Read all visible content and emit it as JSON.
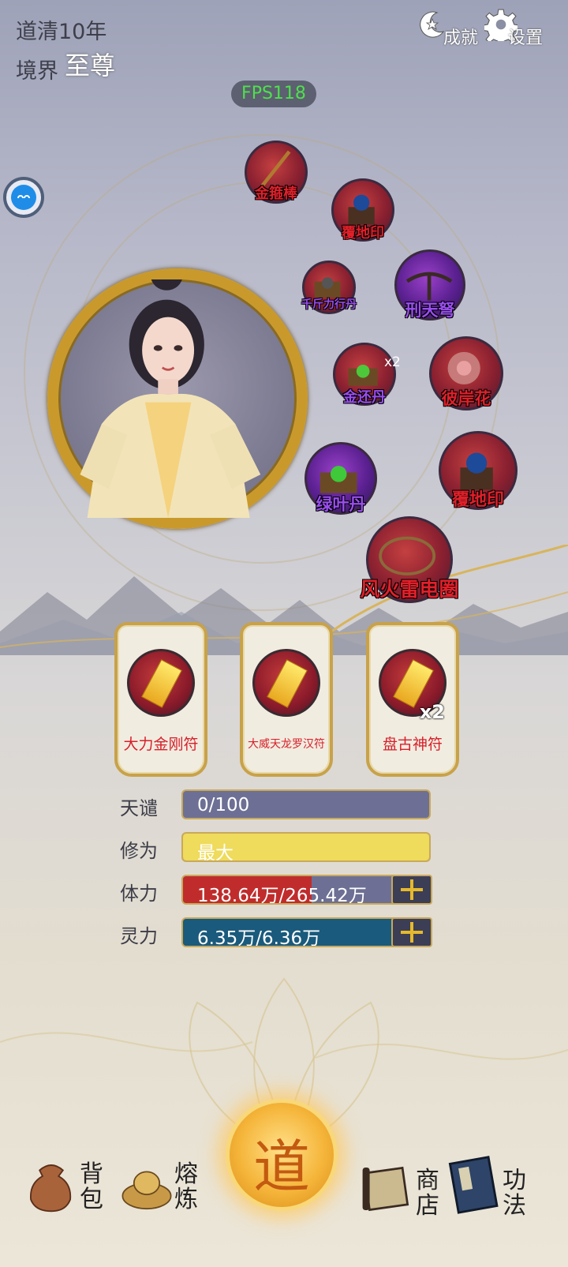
{
  "header": {
    "era": "道清10年",
    "realm_label": "境界",
    "realm_value": "至尊",
    "achievements_label": "成就",
    "settings_label": "设置",
    "fps": "FPS118"
  },
  "items": [
    {
      "name": "金箍棒"
    },
    {
      "name": "覆地印"
    },
    {
      "name": "千斤力行丹"
    },
    {
      "name": "刑天弩"
    },
    {
      "name": "金还丹",
      "qty": "x2"
    },
    {
      "name": "彼岸花"
    },
    {
      "name": "绿叶丹"
    },
    {
      "name": "覆地印"
    },
    {
      "name": "风火雷电圈"
    }
  ],
  "talismans": [
    {
      "name": "大力金刚符"
    },
    {
      "name": "大威天龙罗汉符"
    },
    {
      "name": "盘古神符",
      "qty": "x2"
    }
  ],
  "stats": {
    "tianqian": {
      "label": "天谴",
      "value": "0/100",
      "fill": 0.0
    },
    "xiuwei": {
      "label": "修为",
      "value": "最大",
      "fill": 1.0
    },
    "tili": {
      "label": "体力",
      "value": "138.64万/265.42万",
      "fill": 0.522
    },
    "lingli": {
      "label": "灵力",
      "value": "6.35万/6.36万",
      "fill": 0.998
    }
  },
  "nav": {
    "bag": "背包",
    "smelt": "熔炼",
    "dao": "道",
    "shop": "商店",
    "skills": "功法"
  },
  "colors": {
    "gold": "#c99a2b",
    "item_red": "#e0202a",
    "item_purple": "#9a4ef0",
    "fps_green": "#4ee04e"
  }
}
